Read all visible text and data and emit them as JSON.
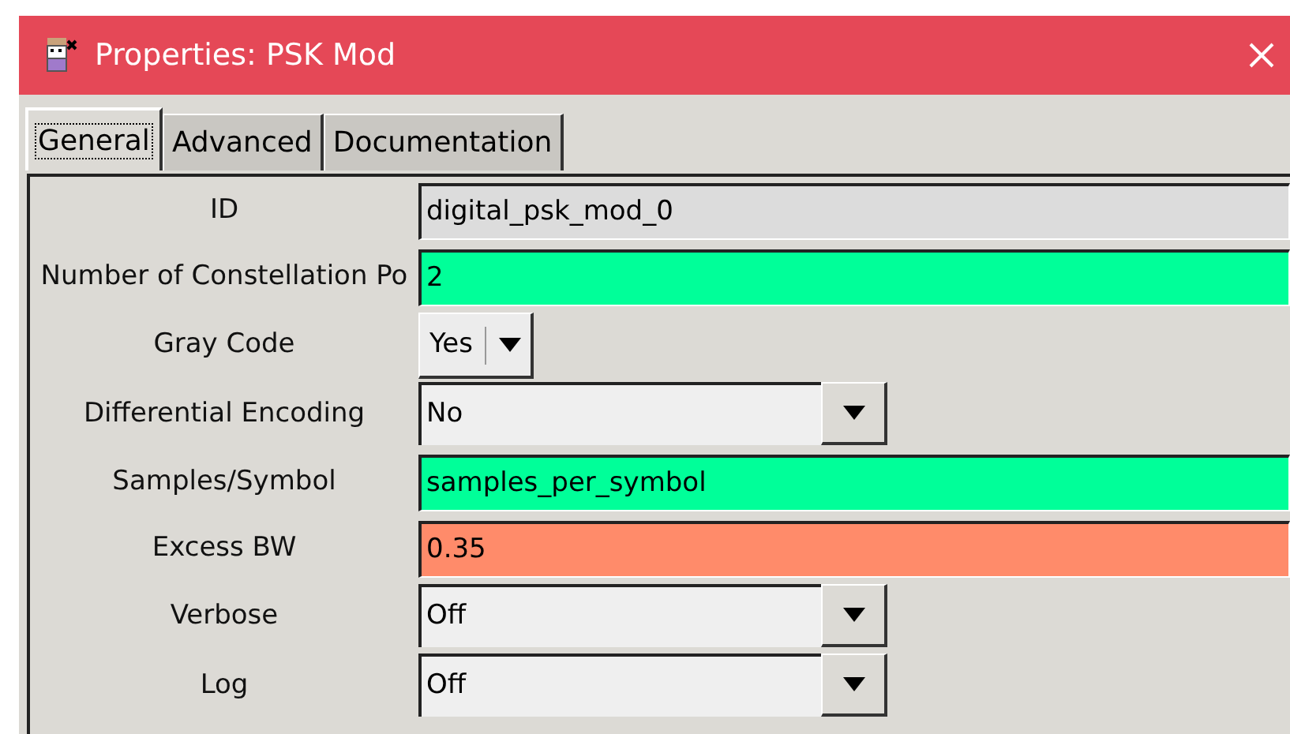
{
  "window": {
    "title": "Properties: PSK Mod"
  },
  "tabs": [
    {
      "label": "General",
      "selected": true
    },
    {
      "label": "Advanced",
      "selected": false
    },
    {
      "label": "Documentation",
      "selected": false
    }
  ],
  "params": [
    {
      "label": "ID",
      "kind": "entry",
      "value": "digital_psk_mod_0",
      "color": "#dcdcdc"
    },
    {
      "label": "Number of Constellation Po",
      "kind": "entry",
      "value": "2",
      "color": "#00ff99"
    },
    {
      "label": "Gray Code",
      "kind": "compact_combo",
      "value": "Yes"
    },
    {
      "label": "Differential Encoding",
      "kind": "combo",
      "value": "No"
    },
    {
      "label": "Samples/Symbol",
      "kind": "entry",
      "value": "samples_per_symbol",
      "color": "#00ff99"
    },
    {
      "label": "Excess BW",
      "kind": "entry",
      "value": "0.35",
      "color": "#ff8b6a"
    },
    {
      "label": "Verbose",
      "kind": "combo",
      "value": "Off"
    },
    {
      "label": "Log",
      "kind": "combo",
      "value": "Off"
    }
  ]
}
